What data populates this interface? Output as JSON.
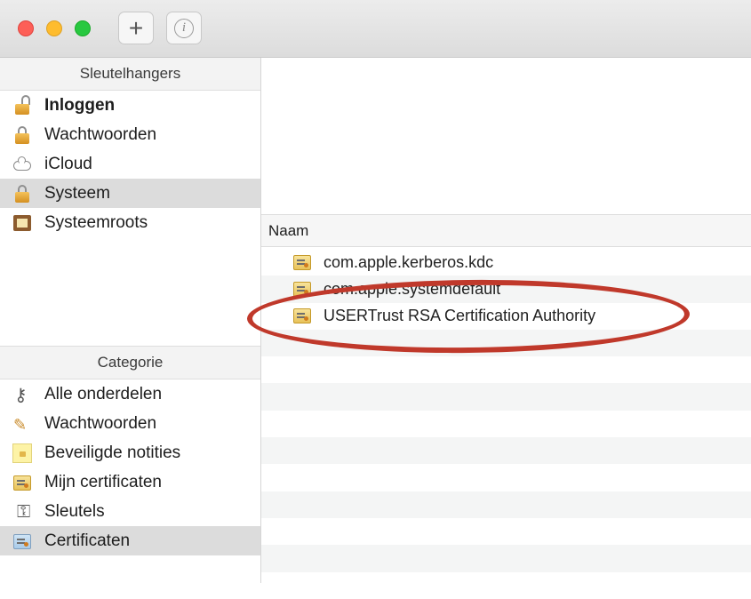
{
  "toolbar": {
    "add_label": "+",
    "info_label": "i"
  },
  "sidebar": {
    "keychains_header": "Sleutelhangers",
    "keychains": [
      {
        "label": "Inloggen",
        "icon": "open-lock-icon"
      },
      {
        "label": "Wachtwoorden",
        "icon": "lock-icon"
      },
      {
        "label": "iCloud",
        "icon": "cloud-icon"
      },
      {
        "label": "Systeem",
        "icon": "lock-icon",
        "selected": true
      },
      {
        "label": "Systeemroots",
        "icon": "cabinet-icon"
      }
    ],
    "categories_header": "Categorie",
    "categories": [
      {
        "label": "Alle onderdelen",
        "icon": "keys-icon"
      },
      {
        "label": "Wachtwoorden",
        "icon": "pen-icon"
      },
      {
        "label": "Beveiligde notities",
        "icon": "secure-note-icon"
      },
      {
        "label": "Mijn certificaten",
        "icon": "certificate-icon"
      },
      {
        "label": "Sleutels",
        "icon": "key-icon"
      },
      {
        "label": "Certificaten",
        "icon": "certificate-icon",
        "selected": true
      }
    ]
  },
  "list": {
    "column_name": "Naam",
    "rows": [
      {
        "name": "com.apple.kerberos.kdc"
      },
      {
        "name": "com.apple.systemdefault"
      },
      {
        "name": "USERTrust RSA Certification Authority"
      }
    ]
  },
  "colors": {
    "annotation": "#c0392b",
    "selection": "#dcdcdc"
  }
}
